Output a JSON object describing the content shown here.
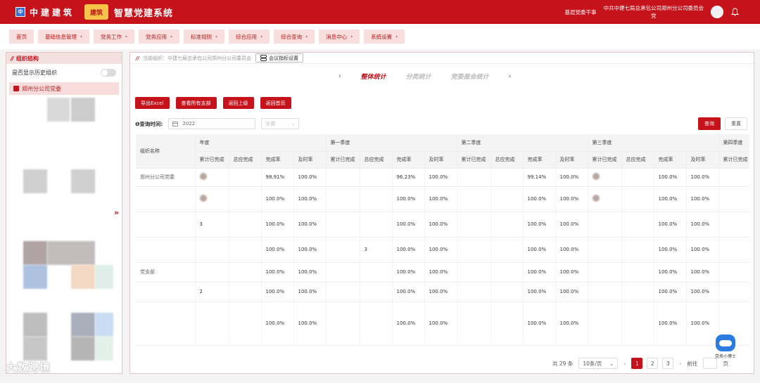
{
  "header": {
    "logo_char": "中",
    "company_name": "中建建筑",
    "brand_emblem": "建筑",
    "system_title": "智慧党建系统",
    "user_role": "基层党委干事",
    "user_org": "中共中建七局总承包公司郑州分公司委员会",
    "user_org_suffix": "党"
  },
  "nav": {
    "items": [
      {
        "label": "首页",
        "chevron": false
      },
      {
        "label": "基础信息管理",
        "chevron": true
      },
      {
        "label": "党务工作",
        "chevron": true
      },
      {
        "label": "党务应用",
        "chevron": true
      },
      {
        "label": "标准规则",
        "chevron": true
      },
      {
        "label": "综合应用",
        "chevron": true
      },
      {
        "label": "综合查询",
        "chevron": true
      },
      {
        "label": "消息中心",
        "chevron": true
      },
      {
        "label": "系统设置",
        "chevron": true
      }
    ]
  },
  "left_panel": {
    "title": "组织结构",
    "history_toggle_label": "是否显示历史组织",
    "history_toggle_on": false,
    "tree_root": "郑州分公司党委"
  },
  "main": {
    "breadcrumb_label": "当前组织：中建七局总承包公司郑州分公司委员会",
    "settings_button": "会议指标设置",
    "tabs": [
      {
        "label": "整体统计",
        "active": true
      },
      {
        "label": "分类统计",
        "active": false
      },
      {
        "label": "党委盖会统计",
        "active": false
      }
    ],
    "action_buttons": [
      "导出Excel",
      "查看所有支部",
      "返回上级",
      "返回首页"
    ],
    "query": {
      "label": "❶查询时间:",
      "year_value": "2022",
      "period_placeholder": "全部",
      "search_button": "查询",
      "reset_button": "重置"
    }
  },
  "table": {
    "org_column": "组织名称",
    "groups": [
      "年度",
      "第一季度",
      "第二季度",
      "第三季度",
      "第四季度"
    ],
    "sub_columns": [
      "累计已完成",
      "总应完成",
      "完成率",
      "及时率"
    ],
    "rows": [
      {
        "name": "郑州分公司党委",
        "cells": [
          [
            "",
            "",
            "98.91%",
            "100.0%"
          ],
          [
            "",
            "",
            "96.23%",
            "100.0%"
          ],
          [
            "",
            "",
            "99.14%",
            "100.0%"
          ],
          [
            "",
            "",
            "100.0%",
            "100.0%"
          ],
          [
            ""
          ]
        ]
      },
      {
        "name": "",
        "cells": [
          [
            "",
            "",
            "100.0%",
            "100.0%"
          ],
          [
            "",
            "",
            "100.0%",
            "100.0%"
          ],
          [
            "",
            "",
            "100.0%",
            "100.0%"
          ],
          [
            "",
            "",
            "100.0%",
            "100.0%"
          ],
          [
            ""
          ]
        ]
      },
      {
        "name": "",
        "cells": [
          [
            "3",
            "",
            "100.0%",
            "100.0%"
          ],
          [
            "",
            "",
            "100.0%",
            "100.0%"
          ],
          [
            "",
            "",
            "100.0%",
            "100.0%"
          ],
          [
            "",
            "",
            "100.0%",
            "100.0%"
          ],
          [
            ""
          ]
        ]
      },
      {
        "name": "",
        "cells": [
          [
            "",
            "",
            "100.0%",
            "100.0%"
          ],
          [
            "",
            "3",
            "100.0%",
            "100.0%"
          ],
          [
            "",
            "",
            "100.0%",
            "100.0%"
          ],
          [
            "",
            "",
            "100.0%",
            "100.0%"
          ],
          [
            ""
          ]
        ]
      },
      {
        "name": "党支部",
        "cells": [
          [
            "",
            "",
            "100.0%",
            "100.0%"
          ],
          [
            "",
            "",
            "100.0%",
            "100.0%"
          ],
          [
            "",
            "",
            "100.0%",
            "100.0%"
          ],
          [
            "",
            "",
            "100.0%",
            "100.0%"
          ],
          [
            ""
          ]
        ]
      },
      {
        "name": "",
        "cells": [
          [
            "2",
            "",
            "100.0%",
            "100.0%"
          ],
          [
            "",
            "",
            "100.0%",
            "100.0%"
          ],
          [
            "",
            "",
            "100.0%",
            "100.0%"
          ],
          [
            "",
            "",
            "100.0%",
            "100.0%"
          ],
          [
            ""
          ]
        ]
      },
      {
        "name": "",
        "cells": [
          [
            "",
            "",
            "100.0%",
            "100.0%"
          ],
          [
            "",
            "",
            "100.0%",
            "100.0%"
          ],
          [
            "",
            "",
            "100.0%",
            "100.0%"
          ],
          [
            "",
            "",
            "100.0%",
            "100.0%"
          ],
          [
            ""
          ]
        ]
      }
    ]
  },
  "pagination": {
    "total": "共 29 条",
    "page_size": "10条/页",
    "pages": [
      "1",
      "2",
      "3"
    ],
    "active_page": "1",
    "goto_prefix": "前往",
    "goto_suffix": "页"
  },
  "mascot_label": "党务小博士",
  "watermark": "大数跨境",
  "colors": {
    "brand_red": "#c5121b",
    "nav_bg": "#f9dede",
    "mascot_blue": "#2c7be0"
  }
}
